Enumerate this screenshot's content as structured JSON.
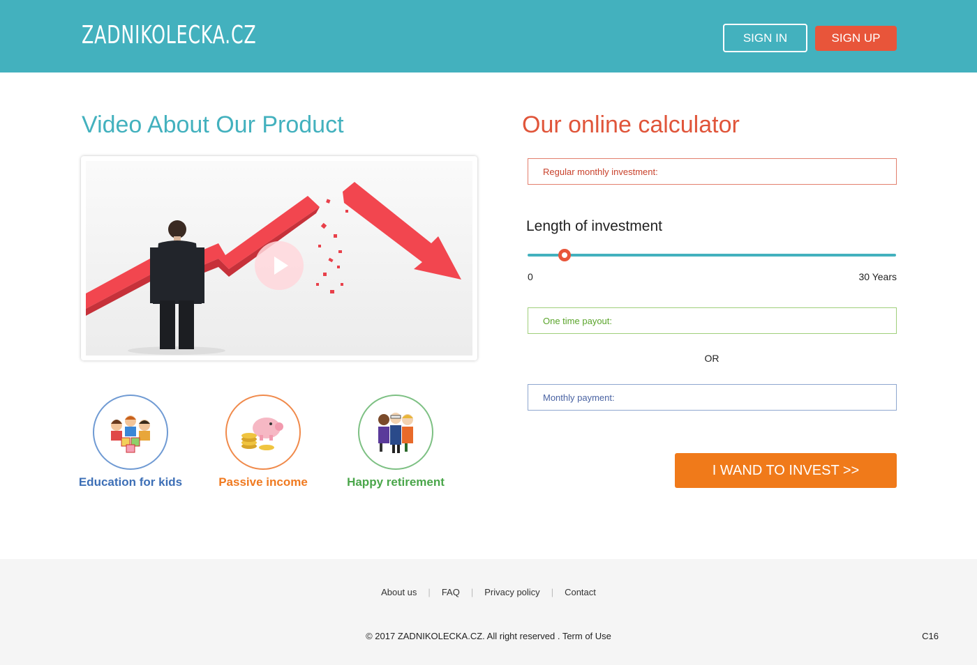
{
  "header": {
    "logo": "ZADNIKOLECKA.CZ",
    "sign_in": "SIGN IN",
    "sign_up": "SIGN UP"
  },
  "video": {
    "title": "Video About Our Product"
  },
  "features": [
    {
      "label": "Education for kids",
      "icon": "kids-books-icon"
    },
    {
      "label": "Passive income",
      "icon": "piggy-bank-icon"
    },
    {
      "label": "Happy retirement",
      "icon": "elderly-couple-icon"
    }
  ],
  "calculator": {
    "title": "Our online calculator",
    "monthly_investment_placeholder": "Regular monthly investment:",
    "length_label": "Length of investment",
    "slider_min": "0",
    "slider_max": "30 Years",
    "slider_value_fraction": 0.1,
    "one_time_payout_placeholder": "One time payout:",
    "or_text": "OR",
    "monthly_payment_placeholder": "Monthly payment:",
    "invest_button": "I WAND TO INVEST >>"
  },
  "footer": {
    "links": [
      "About us",
      "FAQ",
      "Privacy policy",
      "Contact"
    ],
    "copyright": "© 2017 ZADNIKOLECKA.CZ.  All right reserved . Term of Use",
    "build": "C16"
  },
  "colors": {
    "header_bg": "#43b1be",
    "accent_red": "#e8553a",
    "accent_orange": "#f07a1a"
  }
}
